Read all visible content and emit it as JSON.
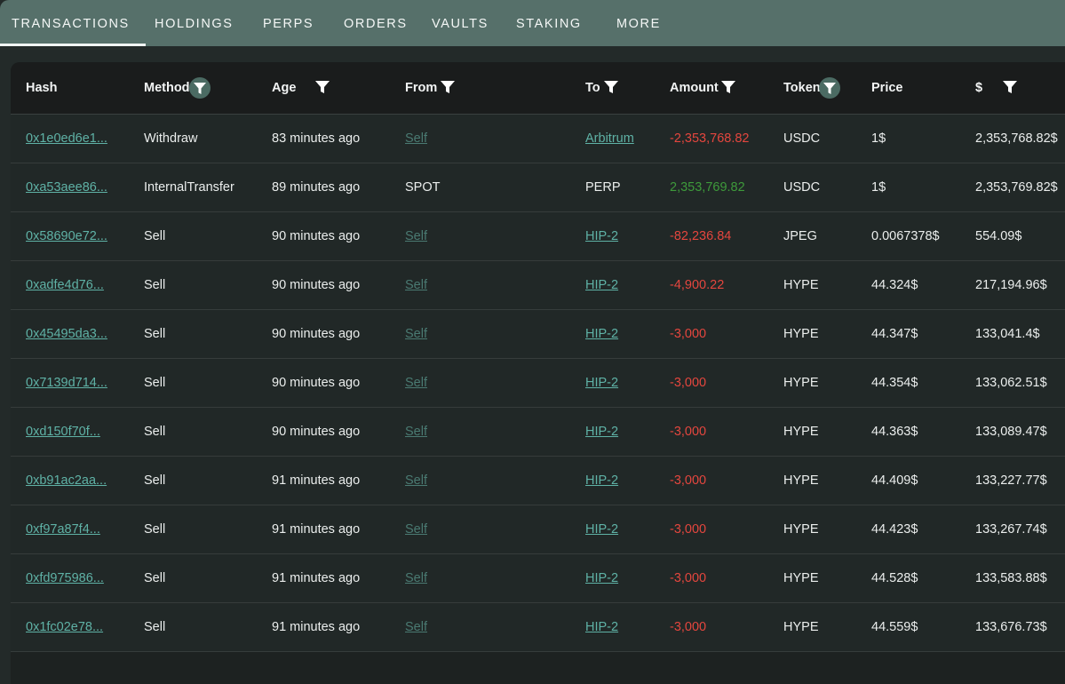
{
  "tabs": [
    {
      "label": "TRANSACTIONS",
      "active": true
    },
    {
      "label": "HOLDINGS",
      "active": false
    },
    {
      "label": "PERPS",
      "active": false
    },
    {
      "label": "ORDERS",
      "active": false
    },
    {
      "label": "VAULTS",
      "active": false
    },
    {
      "label": "STAKING",
      "active": false
    },
    {
      "label": "MORE",
      "active": false
    }
  ],
  "columns": [
    {
      "label": "Hash",
      "filter": "none"
    },
    {
      "label": "Method",
      "filter": "active"
    },
    {
      "label": "Age",
      "filter": "plain"
    },
    {
      "label": "From",
      "filter": "plain"
    },
    {
      "label": "To",
      "filter": "plain"
    },
    {
      "label": "Amount",
      "filter": "plain"
    },
    {
      "label": "Token",
      "filter": "active"
    },
    {
      "label": "Price",
      "filter": "none"
    },
    {
      "label": "$",
      "filter": "plain"
    }
  ],
  "colors": {
    "tabbar": "#56706a",
    "link": "#5fb2a6",
    "negative": "#e4463e",
    "positive": "#3e9a3b"
  },
  "rows": [
    {
      "hash": "0x1e0ed6e1...",
      "method": "Withdraw",
      "age": "83 minutes ago",
      "from": "Self",
      "from_link": true,
      "to": "Arbitrum",
      "to_link": true,
      "amount": "-2,353,768.82",
      "sign": "neg",
      "token": "USDC",
      "price": "1$",
      "usd": "2,353,768.82$"
    },
    {
      "hash": "0xa53aee86...",
      "method": "InternalTransfer",
      "age": "89 minutes ago",
      "from": "SPOT",
      "from_link": false,
      "to": "PERP",
      "to_link": false,
      "amount": "2,353,769.82",
      "sign": "pos",
      "token": "USDC",
      "price": "1$",
      "usd": "2,353,769.82$"
    },
    {
      "hash": "0x58690e72...",
      "method": "Sell",
      "age": "90 minutes ago",
      "from": "Self",
      "from_link": true,
      "to": "HIP-2",
      "to_link": true,
      "amount": "-82,236.84",
      "sign": "neg",
      "token": "JPEG",
      "price": "0.0067378$",
      "usd": "554.09$"
    },
    {
      "hash": "0xadfe4d76...",
      "method": "Sell",
      "age": "90 minutes ago",
      "from": "Self",
      "from_link": true,
      "to": "HIP-2",
      "to_link": true,
      "amount": "-4,900.22",
      "sign": "neg",
      "token": "HYPE",
      "price": "44.324$",
      "usd": "217,194.96$"
    },
    {
      "hash": "0x45495da3...",
      "method": "Sell",
      "age": "90 minutes ago",
      "from": "Self",
      "from_link": true,
      "to": "HIP-2",
      "to_link": true,
      "amount": "-3,000",
      "sign": "neg",
      "token": "HYPE",
      "price": "44.347$",
      "usd": "133,041.4$"
    },
    {
      "hash": "0x7139d714...",
      "method": "Sell",
      "age": "90 minutes ago",
      "from": "Self",
      "from_link": true,
      "to": "HIP-2",
      "to_link": true,
      "amount": "-3,000",
      "sign": "neg",
      "token": "HYPE",
      "price": "44.354$",
      "usd": "133,062.51$"
    },
    {
      "hash": "0xd150f70f...",
      "method": "Sell",
      "age": "90 minutes ago",
      "from": "Self",
      "from_link": true,
      "to": "HIP-2",
      "to_link": true,
      "amount": "-3,000",
      "sign": "neg",
      "token": "HYPE",
      "price": "44.363$",
      "usd": "133,089.47$"
    },
    {
      "hash": "0xb91ac2aa...",
      "method": "Sell",
      "age": "91 minutes ago",
      "from": "Self",
      "from_link": true,
      "to": "HIP-2",
      "to_link": true,
      "amount": "-3,000",
      "sign": "neg",
      "token": "HYPE",
      "price": "44.409$",
      "usd": "133,227.77$"
    },
    {
      "hash": "0xf97a87f4...",
      "method": "Sell",
      "age": "91 minutes ago",
      "from": "Self",
      "from_link": true,
      "to": "HIP-2",
      "to_link": true,
      "amount": "-3,000",
      "sign": "neg",
      "token": "HYPE",
      "price": "44.423$",
      "usd": "133,267.74$"
    },
    {
      "hash": "0xfd975986...",
      "method": "Sell",
      "age": "91 minutes ago",
      "from": "Self",
      "from_link": true,
      "to": "HIP-2",
      "to_link": true,
      "amount": "-3,000",
      "sign": "neg",
      "token": "HYPE",
      "price": "44.528$",
      "usd": "133,583.88$"
    },
    {
      "hash": "0x1fc02e78...",
      "method": "Sell",
      "age": "91 minutes ago",
      "from": "Self",
      "from_link": true,
      "to": "HIP-2",
      "to_link": true,
      "amount": "-3,000",
      "sign": "neg",
      "token": "HYPE",
      "price": "44.559$",
      "usd": "133,676.73$"
    }
  ]
}
